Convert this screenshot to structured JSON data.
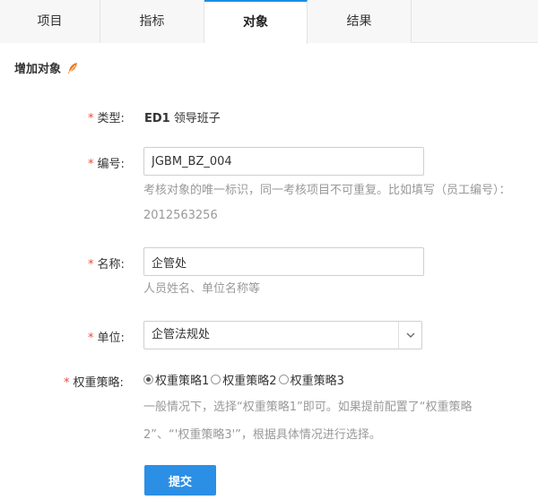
{
  "tabs": [
    {
      "label": "项目",
      "active": false
    },
    {
      "label": "指标",
      "active": false
    },
    {
      "label": "对象",
      "active": true
    },
    {
      "label": "结果",
      "active": false
    }
  ],
  "section": {
    "title": "增加对象",
    "icon": "feather-icon"
  },
  "form": {
    "required_mark": "*",
    "type": {
      "label": "类型:",
      "code": "ED1",
      "name": "领导班子"
    },
    "code": {
      "label": "编号:",
      "value": "JGBM_BZ_004",
      "hint_line1": "考核对象的唯一标识，同一考核项目不可重复。比如填写（员工编号）：",
      "hint_line2": "2012563256"
    },
    "name": {
      "label": "名称:",
      "value": "企管处",
      "hint": "人员姓名、单位名称等"
    },
    "unit": {
      "label": "单位:",
      "value": "企管法规处"
    },
    "weight": {
      "label": "权重策略:",
      "options": [
        {
          "label": "权重策略1",
          "checked": true
        },
        {
          "label": "权重策略2",
          "checked": false
        },
        {
          "label": "权重策略3",
          "checked": false
        }
      ],
      "hint_line1": "一般情况下，选择“权重策略1”即可。如果提前配置了“权重策略",
      "hint_line2": "2”、“'权重策略3'”，根据具体情况进行选择。"
    },
    "submit_label": "提交"
  },
  "colors": {
    "accent": "#2b8fe6",
    "required": "#e84a3c",
    "hint": "#999999",
    "feather": "#f07a1e"
  }
}
